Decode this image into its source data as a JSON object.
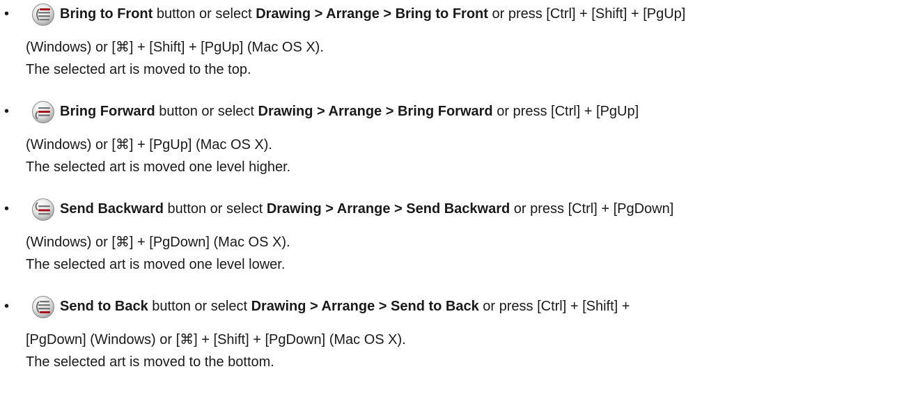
{
  "items": [
    {
      "icon": "bring-to-front-icon",
      "name": "Bring to Front",
      "t1": " button or select ",
      "menu": "Drawing > Arrange > Bring to Front",
      "t2": " or press [Ctrl] + [Shift] + [PgUp]",
      "cont": "(Windows) or [⌘] + [Shift] + [PgUp] (Mac OS X).",
      "desc": "The selected art is moved to the top."
    },
    {
      "icon": "bring-forward-icon",
      "name": "Bring Forward",
      "t1": " button or select ",
      "menu": "Drawing > Arrange > Bring Forward",
      "t2": " or press [Ctrl] + [PgUp]",
      "cont": "(Windows) or [⌘] + [PgUp] (Mac OS X).",
      "desc": "The selected art is moved one level higher."
    },
    {
      "icon": "send-backward-icon",
      "name": "Send Backward",
      "t1": " button or select ",
      "menu": "Drawing > Arrange > Send Backward",
      "t2": " or press [Ctrl] + [PgDown]",
      "cont": "(Windows) or [⌘] + [PgDown] (Mac OS X).",
      "desc": "The selected art is moved one level lower."
    },
    {
      "icon": "send-to-back-icon",
      "name": "Send to Back",
      "t1": " button or select ",
      "menu": "Drawing > Arrange > Send to Back",
      "t2": " or press [Ctrl] + [Shift] +",
      "cont": "[PgDown] (Windows) or [⌘] + [Shift] + [PgDown] (Mac OS X).",
      "desc": "The selected art is moved to the bottom."
    }
  ]
}
